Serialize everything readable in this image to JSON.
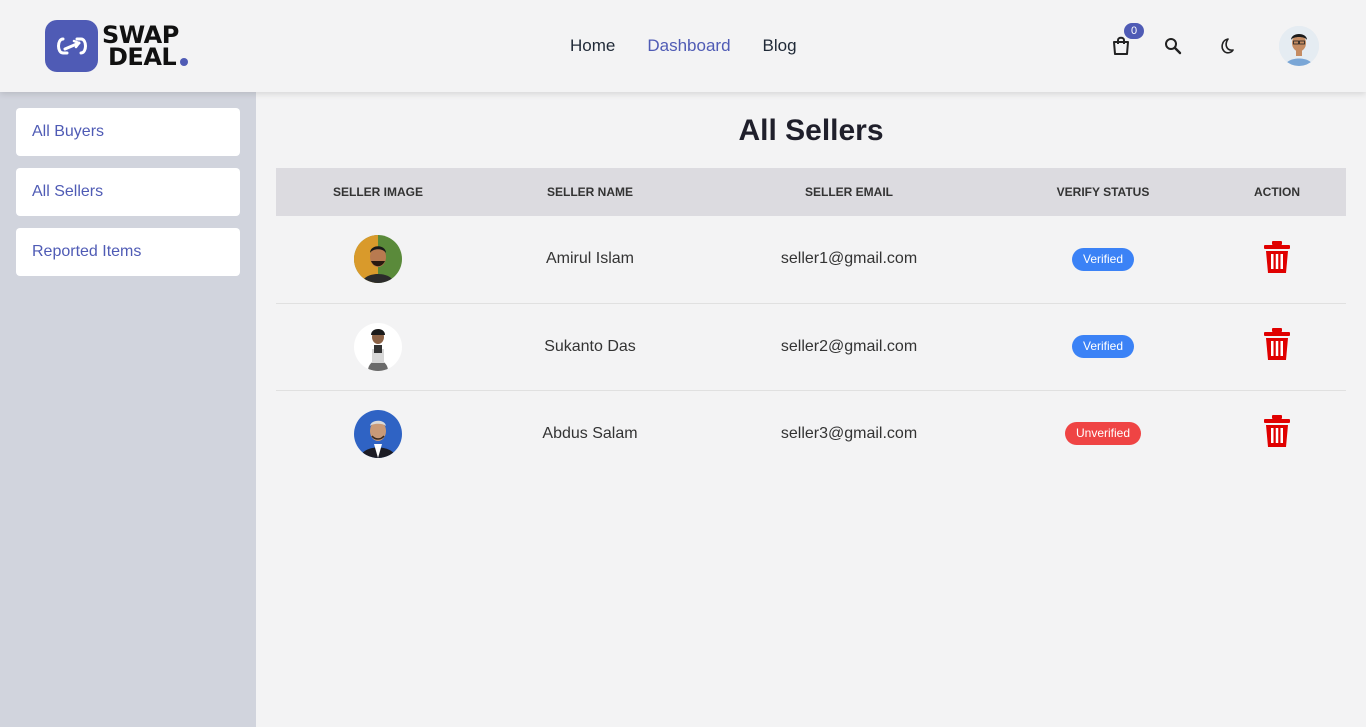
{
  "brand": {
    "line1": "SWAP",
    "line2": "DEAL",
    "accent": "#4f5bb5"
  },
  "nav": {
    "items": [
      "Home",
      "Dashboard",
      "Blog"
    ],
    "active": "Dashboard"
  },
  "header": {
    "cart_count": "0",
    "icons": [
      "cart-icon",
      "search-icon",
      "moon-icon",
      "user-avatar"
    ]
  },
  "sidebar": {
    "items": [
      {
        "label": "All Buyers"
      },
      {
        "label": "All Sellers"
      },
      {
        "label": "Reported Items"
      }
    ]
  },
  "page": {
    "title": "All Sellers"
  },
  "table": {
    "headers": [
      "SELLER IMAGE",
      "SELLER NAME",
      "SELLER EMAIL",
      "VERIFY STATUS",
      "ACTION"
    ],
    "rows": [
      {
        "name": "Amirul Islam",
        "email": "seller1@gmail.com",
        "status": "Verified"
      },
      {
        "name": "Sukanto Das",
        "email": "seller2@gmail.com",
        "status": "Verified"
      },
      {
        "name": "Abdus Salam",
        "email": "seller3@gmail.com",
        "status": "Unverified"
      }
    ]
  },
  "colors": {
    "verified": "#3b82f6",
    "unverified": "#ef4444",
    "delete": "#e00000"
  }
}
